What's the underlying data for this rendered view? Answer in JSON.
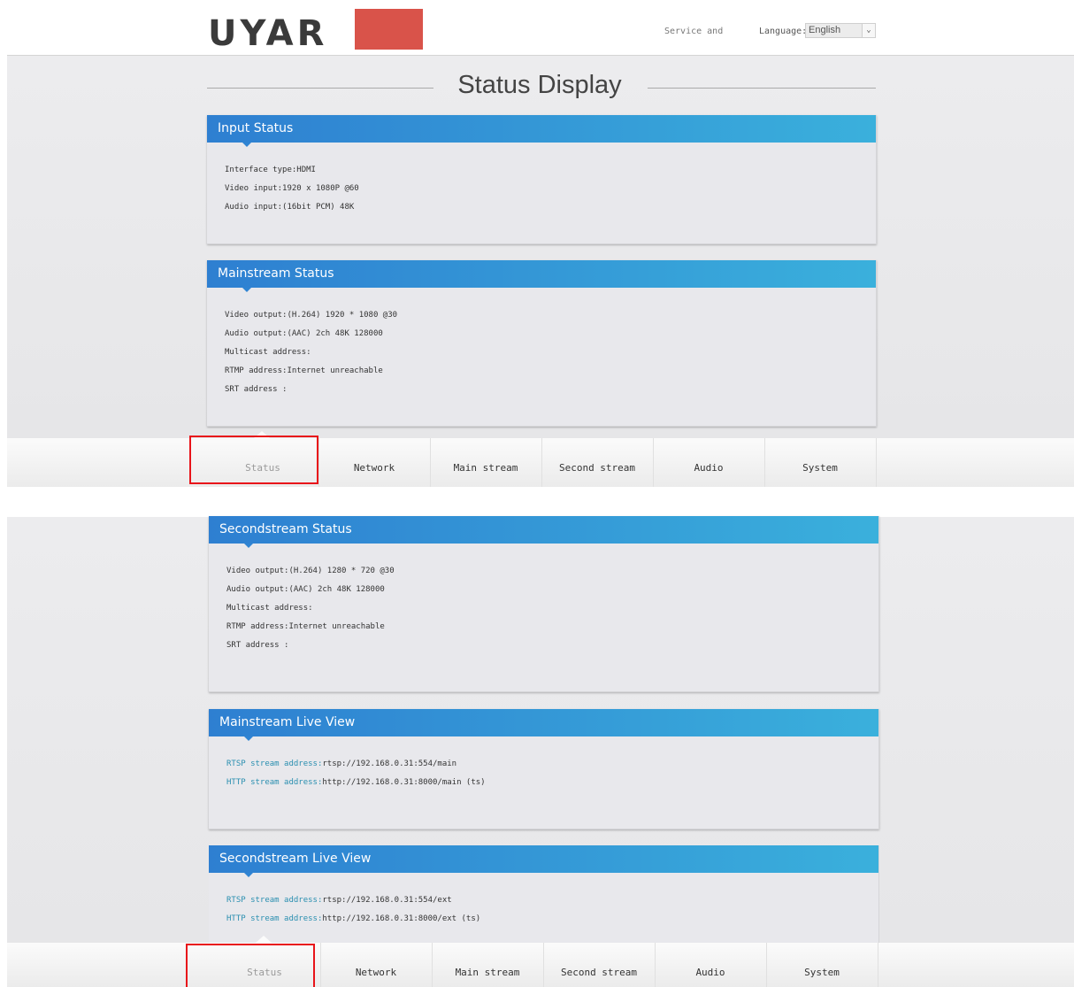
{
  "header": {
    "logo_text": "UYAR",
    "service_link": "Service and",
    "language_label": "Language:",
    "language_value": "English"
  },
  "page_title": "Status Display",
  "panels": {
    "input": {
      "title": "Input Status",
      "lines": [
        "Interface type:HDMI",
        "Video input:1920 x 1080P @60",
        "Audio input:(16bit PCM) 48K"
      ]
    },
    "mainstream": {
      "title": "Mainstream Status",
      "lines": [
        "Video output:(H.264) 1920 * 1080 @30",
        "Audio output:(AAC) 2ch 48K 128000",
        "Multicast address:",
        "RTMP address:Internet unreachable",
        "SRT address :"
      ]
    },
    "secondstream": {
      "title": "Secondstream Status",
      "lines": [
        "Video output:(H.264) 1280 * 720 @30",
        "Audio output:(AAC) 2ch 48K 128000",
        "Multicast address:",
        "RTMP address:Internet unreachable",
        "SRT address :"
      ]
    },
    "main_live": {
      "title": "Mainstream Live View",
      "rtsp_label": "RTSP stream address:",
      "rtsp_value": "rtsp://192.168.0.31:554/main",
      "http_label": "HTTP stream address:",
      "http_value": "http://192.168.0.31:8000/main (ts)"
    },
    "second_live": {
      "title": "Secondstream Live View",
      "rtsp_label": "RTSP stream address:",
      "rtsp_value": "rtsp://192.168.0.31:554/ext",
      "http_label": "HTTP stream address:",
      "http_value": "http://192.168.0.31:8000/ext (ts)"
    }
  },
  "nav": {
    "tabs": [
      "Status",
      "Network",
      "Main stream",
      "Second stream",
      "Audio",
      "System"
    ],
    "active": "Status"
  },
  "colors": {
    "header_gradient_start": "#2e7fd1",
    "header_gradient_end": "#3ab0dc",
    "logo_accent": "#d9534a",
    "highlight": "#e8141a",
    "link": "#2a8fb0"
  }
}
